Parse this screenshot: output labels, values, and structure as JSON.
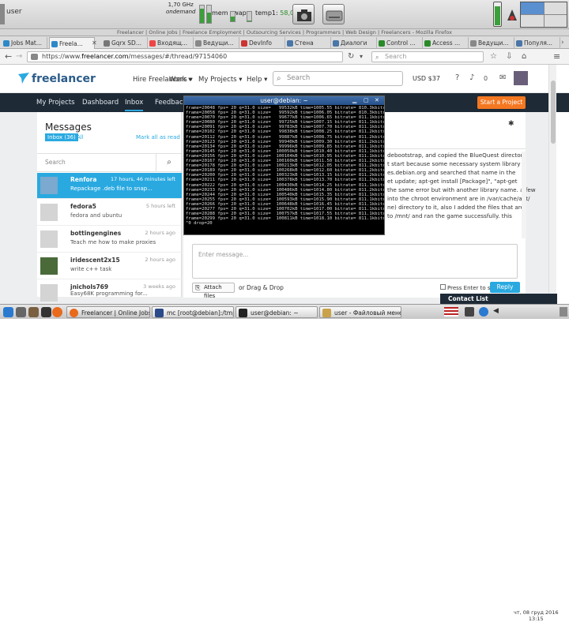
{
  "panel": {
    "user": "user",
    "cpu_freq": "1,70 GHz",
    "cpu_governor": "ondemand",
    "mem_label": "mem",
    "swap_label": "swap",
    "temp_label": "temp1:",
    "temp_value": "58,0"
  },
  "firefox": {
    "title_bar": "Freelancer | Online Jobs | Freelance Employment | Outsourcing Services | Programmers | Web Design | Freelancers - Mozilla Firefox",
    "tabs": [
      "Jobs Mat...",
      "Freela...",
      "Gqrx SD...",
      "Входящ...",
      "Ведущи...",
      "DevInfo",
      "Стена",
      "Диалоги",
      "Control ...",
      "Access ...",
      "Ведущи...",
      "Популя..."
    ],
    "url_prefix": "https://www.",
    "url_host": "freelancer.com",
    "url_path": "/messages/#/thread/97154060",
    "search_placeholder": "Search"
  },
  "freelancer": {
    "logo": "freelancer",
    "nav": [
      "Hire Freelancers ▾",
      "Work ▾",
      "My Projects ▾",
      "Help ▾"
    ],
    "search_placeholder": "Search",
    "balance": "USD $37",
    "notification_count": "0",
    "subnav": [
      "My Projects",
      "Dashboard",
      "Inbox",
      "Feedback"
    ],
    "start_project": "Start a Project"
  },
  "messages": {
    "title": "Messages",
    "inbox_tag": "Inbox (36)",
    "all_tag": "All",
    "mark_read": "Mark all as read",
    "search_placeholder": "Search",
    "conversations": [
      {
        "name": "Renfora",
        "time": "17 hours, 46 minutes left",
        "preview": "Repackage .deb file to snap..."
      },
      {
        "name": "fedora5",
        "time": "5 hours left",
        "preview": "fedora and ubuntu"
      },
      {
        "name": "bottingengines",
        "time": "2 hours ago",
        "preview": "Teach me how to make proxies"
      },
      {
        "name": "iridescent2x15",
        "time": "2 hours ago",
        "preview": "write c++ task"
      },
      {
        "name": "jnichols769",
        "time": "3 weeks ago",
        "preview": "Easy68K programming for..."
      }
    ]
  },
  "chat": {
    "lines": [
      "debootstrap, and copied the BlueQuest directory",
      "t start because some necessary system library",
      "es.debian.org and searched that name in the",
      "et update; apt-get install [Package]\", \"apt-get",
      "the same error but with another library name. a few",
      "into the chroot environment are in /var/cache/apt/",
      "ne) directory to it, also I added the files that are",
      "to /mnt/ and ran the game successfully. this"
    ],
    "compose_placeholder": "Enter message...",
    "attach": "Attach files",
    "drag_drop": "or Drag & Drop",
    "press_enter": "Press Enter to send",
    "reply": "Reply",
    "contact_list": "Contact List"
  },
  "terminal": {
    "title": "user@debian: ~",
    "lines": [
      "frame=20048 fps= 20 q=31.0 size=   99532kB time=1005.55 bitrate= 810.3kbits/s du",
      "frame=20058 fps= 20 q=31.0 size=   99592kB time=1006.05 bitrate= 810.3kbits/s du",
      "frame=20070 fps= 20 q=31.0 size=   99677kB time=1006.65 bitrate= 811.1kbits/s du",
      "frame=20080 fps= 20 q=31.0 size=   99725kB time=1007.15 bitrate= 811.1kbits/s du",
      "frame=20091 fps= 20 q=31.0 size=   99783kB time=1007.70 bitrate= 811.1kbits/s du",
      "frame=20102 fps= 20 q=31.0 size=   99838kB time=1008.25 bitrate= 811.2kbits/s du",
      "frame=20112 fps= 20 q=31.0 size=   99887kB time=1008.75 bitrate= 811.2kbits/s du",
      "frame=20123 fps= 20 q=31.0 size=   99940kB time=1009.30 bitrate= 811.2kbits/s du",
      "frame=20134 fps= 20 q=31.0 size=   99996kB time=1009.85 bitrate= 811.1kbits/s du",
      "frame=20145 fps= 20 q=31.0 size=  100050kB time=1010.40 bitrate= 811.1kbits/s du",
      "frame=20156 fps= 20 q=31.0 size=  100104kB time=1010.95 bitrate= 811.1kbits/s du",
      "frame=20167 fps= 20 q=31.0 size=  100160kB time=1011.50 bitrate= 811.2kbits/s du",
      "frame=20178 fps= 20 q=31.0 size=  100213kB time=1012.05 bitrate= 811.2kbits/s du",
      "frame=20189 fps= 20 q=31.0 size=  100268kB time=1012.60 bitrate= 811.2kbits/s du",
      "frame=20200 fps= 20 q=31.0 size=  100323kB time=1013.15 bitrate= 811.2kbits/s du",
      "frame=20211 fps= 20 q=31.0 size=  100378kB time=1013.70 bitrate= 811.2kbits/s du",
      "frame=20222 fps= 20 q=31.0 size=  100430kB time=1014.25 bitrate= 811.1kbits/s du",
      "frame=20233 fps= 20 q=31.0 size=  100486kB time=1014.80 bitrate= 811.2kbits/s du",
      "frame=20244 fps= 20 q=31.0 size=  100540kB time=1015.35 bitrate= 811.1kbits/s du",
      "frame=20255 fps= 20 q=31.0 size=  100593kB time=1015.90 bitrate= 811.1kbits/s du",
      "frame=20266 fps= 20 q=31.0 size=  100648kB time=1016.45 bitrate= 811.1kbits/s du",
      "frame=20277 fps= 20 q=31.0 size=  100702kB time=1017.00 bitrate= 811.1kbits/s du",
      "frame=20288 fps= 20 q=31.0 size=  100757kB time=1017.55 bitrate= 811.1kbits/s du",
      "frame=20299 fps= 20 q=31.0 size=  100811kB time=1018.10 bitrate= 811.1kbits/s du",
      "^0 drop=20"
    ]
  },
  "taskbar": {
    "items": [
      "Freelancer | Online Jobs |...",
      "mc [root@debian]:/tmp",
      "user@debian: ~",
      "user - Файловый менед..."
    ],
    "date": "чт, 08 груд 2016",
    "time": "13:15"
  },
  "colors": {
    "accent": "#29a9e0",
    "dark_nav": "#1e2a36",
    "start_project": "#f47721"
  }
}
